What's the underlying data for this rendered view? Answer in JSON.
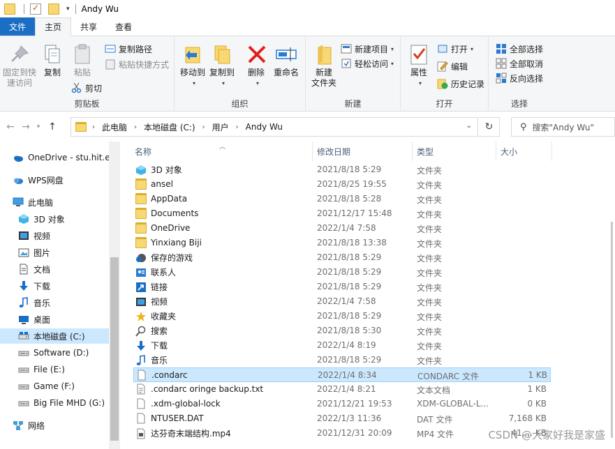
{
  "titlebar": {
    "title": "Andy Wu"
  },
  "ribbon_tabs": [
    "文件",
    "主页",
    "共享",
    "查看"
  ],
  "ribbon": {
    "clipboard": {
      "label": "剪贴板",
      "pin": "固定到快速访问",
      "pin_l1": "固定到快",
      "pin_l2": "速访问",
      "copy": "复制",
      "paste": "粘贴",
      "copy_path": "复制路径",
      "paste_shortcut": "粘贴快捷方式",
      "cut": "剪切"
    },
    "organize": {
      "label": "组织",
      "move_to": "移动到",
      "copy_to": "复制到",
      "delete": "删除",
      "rename": "重命名"
    },
    "new": {
      "label": "新建",
      "new_folder_l1": "新建",
      "new_folder_l2": "文件夹",
      "new_item": "新建项目",
      "easy_access": "轻松访问"
    },
    "open": {
      "label": "打开",
      "properties": "属性",
      "open": "打开",
      "edit": "编辑",
      "history": "历史记录"
    },
    "select": {
      "label": "选择",
      "select_all": "全部选择",
      "select_none": "全部取消",
      "invert": "反向选择"
    }
  },
  "address": {
    "crumbs": [
      "此电脑",
      "本地磁盘 (C:)",
      "用户",
      "Andy Wu"
    ],
    "search_placeholder": "搜索\"Andy Wu\""
  },
  "nav": {
    "items": [
      {
        "label": "OneDrive - stu.hit.edu.cn",
        "icon": "onedrive-cloud-icon"
      },
      {
        "label": "WPS网盘",
        "icon": "wps-cloud-icon"
      },
      {
        "label": "此电脑",
        "icon": "this-pc-icon"
      },
      {
        "label": "3D 对象",
        "icon": "3d-objects-icon"
      },
      {
        "label": "视频",
        "icon": "video-icon"
      },
      {
        "label": "图片",
        "icon": "pictures-icon"
      },
      {
        "label": "文档",
        "icon": "documents-icon"
      },
      {
        "label": "下载",
        "icon": "download-icon"
      },
      {
        "label": "音乐",
        "icon": "music-icon"
      },
      {
        "label": "桌面",
        "icon": "desktop-icon"
      },
      {
        "label": "本地磁盘 (C:)",
        "icon": "local-disk-icon"
      },
      {
        "label": "Software (D:)",
        "icon": "drive-icon"
      },
      {
        "label": "File (E:)",
        "icon": "drive-icon"
      },
      {
        "label": "Game (F:)",
        "icon": "drive-icon"
      },
      {
        "label": "Big File MHD (G:)",
        "icon": "drive-icon"
      },
      {
        "label": "网络",
        "icon": "network-icon"
      }
    ]
  },
  "columns": {
    "name": "名称",
    "date": "修改日期",
    "type": "类型",
    "size": "大小"
  },
  "files": [
    {
      "name": "3D 对象",
      "date": "2021/8/18 5:29",
      "type": "文件夹",
      "size": "",
      "icon": "3d-objects-icon"
    },
    {
      "name": "ansel",
      "date": "2021/8/25 19:55",
      "type": "文件夹",
      "size": "",
      "icon": "folder-icon"
    },
    {
      "name": "AppData",
      "date": "2021/8/18 5:28",
      "type": "文件夹",
      "size": "",
      "icon": "folder-icon"
    },
    {
      "name": "Documents",
      "date": "2021/12/17 15:48",
      "type": "文件夹",
      "size": "",
      "icon": "folder-icon"
    },
    {
      "name": "OneDrive",
      "date": "2022/1/4 7:58",
      "type": "文件夹",
      "size": "",
      "icon": "folder-icon"
    },
    {
      "name": "Yinxiang Biji",
      "date": "2021/8/18 13:38",
      "type": "文件夹",
      "size": "",
      "icon": "folder-icon"
    },
    {
      "name": "保存的游戏",
      "date": "2021/8/18 5:29",
      "type": "文件夹",
      "size": "",
      "icon": "saved-games-icon"
    },
    {
      "name": "联系人",
      "date": "2021/8/18 5:29",
      "type": "文件夹",
      "size": "",
      "icon": "contacts-icon"
    },
    {
      "name": "链接",
      "date": "2021/8/18 5:29",
      "type": "文件夹",
      "size": "",
      "icon": "links-icon"
    },
    {
      "name": "视频",
      "date": "2022/1/4 7:58",
      "type": "文件夹",
      "size": "",
      "icon": "video-icon"
    },
    {
      "name": "收藏夹",
      "date": "2021/8/18 5:29",
      "type": "文件夹",
      "size": "",
      "icon": "favorites-star-icon"
    },
    {
      "name": "搜索",
      "date": "2021/8/18 5:30",
      "type": "文件夹",
      "size": "",
      "icon": "search-icon"
    },
    {
      "name": "下载",
      "date": "2022/1/4 8:19",
      "type": "文件夹",
      "size": "",
      "icon": "download-icon"
    },
    {
      "name": "音乐",
      "date": "2021/8/18 5:29",
      "type": "文件夹",
      "size": "",
      "icon": "music-icon"
    },
    {
      "name": ".condarc",
      "date": "2022/1/4 8:34",
      "type": "CONDARC 文件",
      "size": "1 KB",
      "icon": "file-icon"
    },
    {
      "name": ".condarc oringe backup.txt",
      "date": "2022/1/4 8:21",
      "type": "文本文档",
      "size": "1 KB",
      "icon": "text-file-icon"
    },
    {
      "name": ".xdm-global-lock",
      "date": "2021/12/21 19:53",
      "type": "XDM-GLOBAL-L...",
      "size": "0 KB",
      "icon": "file-icon"
    },
    {
      "name": "NTUSER.DAT",
      "date": "2022/1/3 11:36",
      "type": "DAT 文件",
      "size": "7,168 KB",
      "icon": "file-icon"
    },
    {
      "name": "达芬奇末端结构.mp4",
      "date": "2021/12/31 20:09",
      "type": "MP4 文件",
      "size": "41,... KB",
      "icon": "video-file-icon"
    }
  ],
  "selected_file": ".condarc",
  "watermark": "CSDN @大家好我是家盛",
  "colors": {
    "file_tab": "#1a6fc4",
    "selection": "#cce8ff",
    "folder": "#f8d775"
  }
}
